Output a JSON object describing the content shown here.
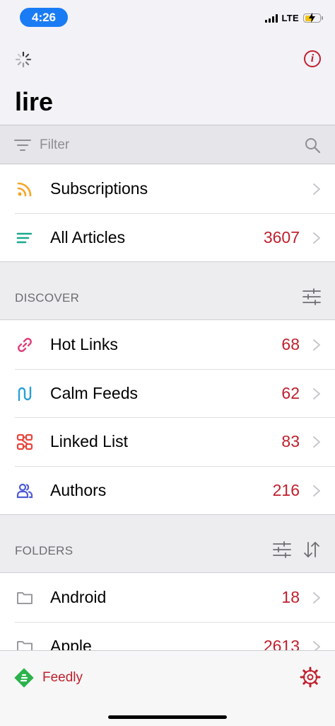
{
  "status_bar": {
    "time": "4:26",
    "network": "LTE"
  },
  "header": {
    "title": "lire"
  },
  "filter": {
    "placeholder": "Filter"
  },
  "top_items": [
    {
      "label": "Subscriptions",
      "count": "",
      "icon": "rss-icon",
      "color": "#f5a623"
    },
    {
      "label": "All Articles",
      "count": "3607",
      "icon": "list-icon",
      "color": "#1aa88e"
    }
  ],
  "discover": {
    "title": "DISCOVER",
    "items": [
      {
        "label": "Hot Links",
        "count": "68",
        "icon": "link-icon",
        "color": "#e0407a"
      },
      {
        "label": "Calm Feeds",
        "count": "62",
        "icon": "calm-feeds-icon",
        "color": "#2a9fd6"
      },
      {
        "label": "Linked List",
        "count": "83",
        "icon": "linked-list-icon",
        "color": "#e8453c"
      },
      {
        "label": "Authors",
        "count": "216",
        "icon": "authors-icon",
        "color": "#4f5bd5"
      }
    ]
  },
  "folders": {
    "title": "FOLDERS",
    "items": [
      {
        "label": "Android",
        "count": "18",
        "icon": "folder-icon"
      },
      {
        "label": "Apple",
        "count": "2613",
        "icon": "folder-icon"
      }
    ]
  },
  "toolbar": {
    "feedly_label": "Feedly"
  },
  "colors": {
    "accent": "#c0202e",
    "time_pill": "#1a7cf5"
  }
}
